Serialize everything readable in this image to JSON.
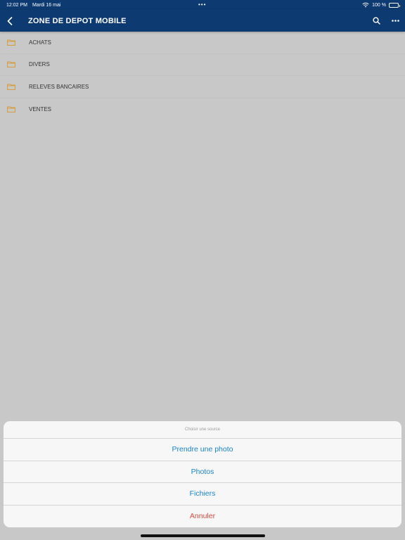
{
  "status_bar": {
    "time": "12:02 PM",
    "date": "Mardi 16 mai",
    "dots": "•••",
    "battery": "100 %"
  },
  "nav": {
    "title": "ZONE DE DEPOT MOBILE",
    "back_icon": "chevron-left-icon",
    "search_icon": "search-icon",
    "more_icon": "ellipsis-icon"
  },
  "folders": [
    {
      "label": "ACHATS"
    },
    {
      "label": "DIVERS"
    },
    {
      "label": "RELEVES BANCAIRES"
    },
    {
      "label": "VENTES"
    }
  ],
  "action_sheet": {
    "title": "Choisir une source",
    "take_photo": "Prendre une photo",
    "photos": "Photos",
    "files": "Fichiers",
    "cancel": "Annuler"
  },
  "colors": {
    "nav_bg": "#0d3a70",
    "folder_icon": "#d69b38",
    "action_blue": "#1a84c8",
    "cancel_red": "#e0493a"
  }
}
